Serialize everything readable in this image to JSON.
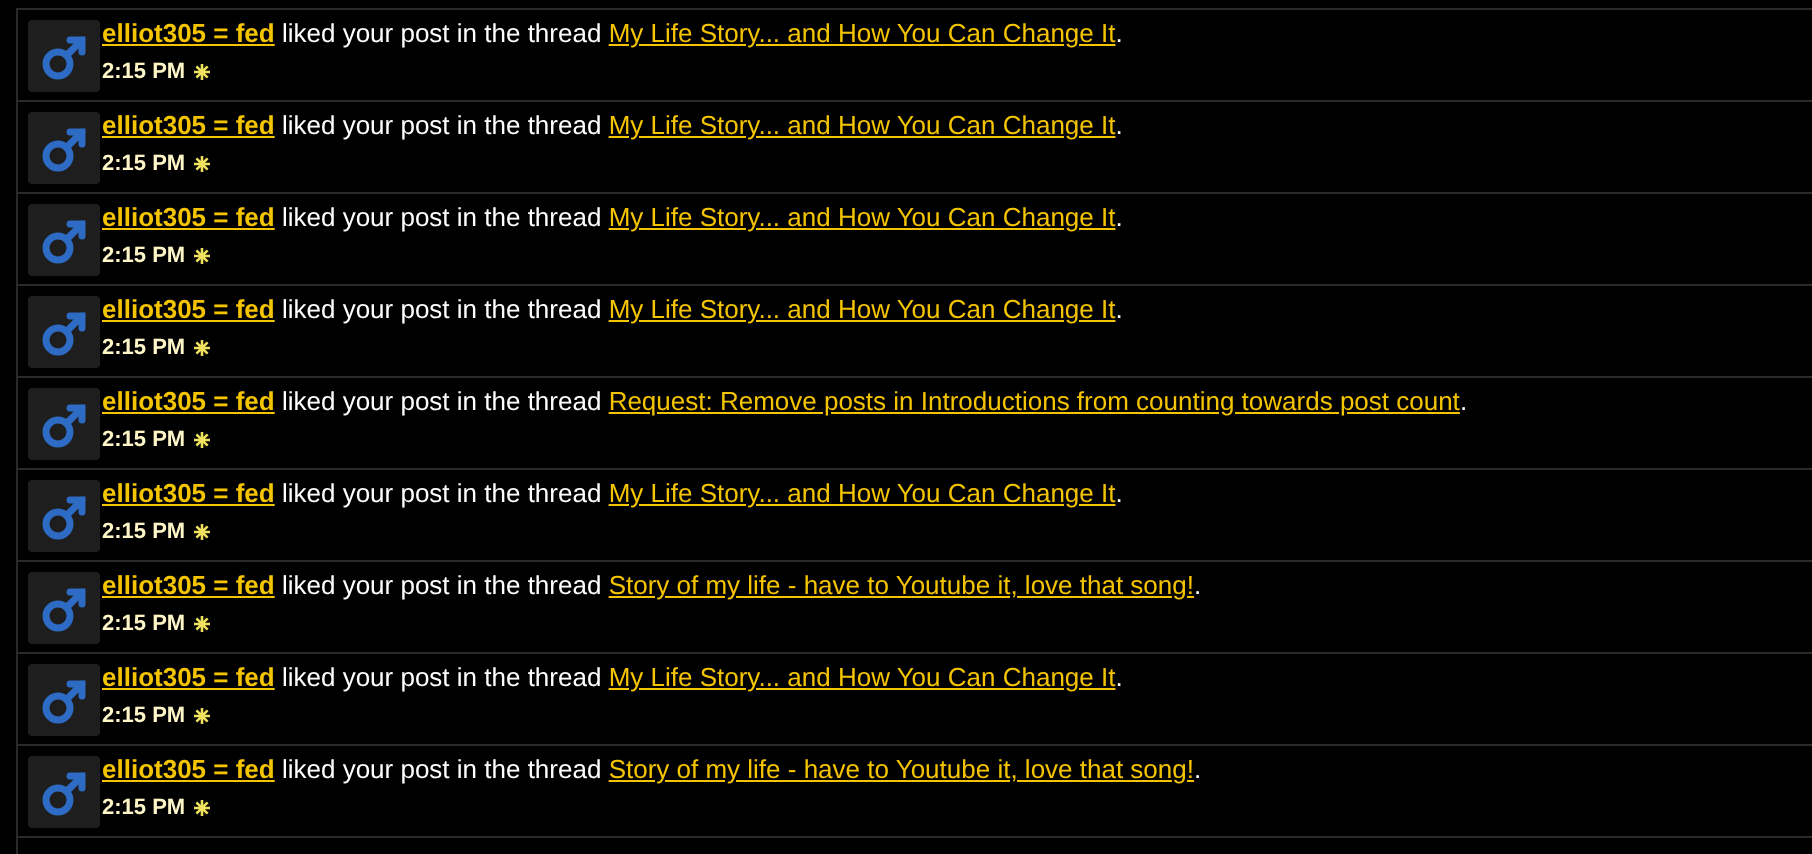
{
  "notifications": [
    {
      "user": "elliot305 = fed",
      "action": "liked your post in the thread",
      "thread": "My Life Story... and How You Can Change It",
      "end": ".",
      "time": "2:15 PM",
      "unread": true
    },
    {
      "user": "elliot305 = fed",
      "action": "liked your post in the thread",
      "thread": "My Life Story... and How You Can Change It",
      "end": ".",
      "time": "2:15 PM",
      "unread": true
    },
    {
      "user": "elliot305 = fed",
      "action": "liked your post in the thread",
      "thread": "My Life Story... and How You Can Change It",
      "end": ".",
      "time": "2:15 PM",
      "unread": true
    },
    {
      "user": "elliot305 = fed",
      "action": "liked your post in the thread",
      "thread": "My Life Story... and How You Can Change It",
      "end": ".",
      "time": "2:15 PM",
      "unread": true
    },
    {
      "user": "elliot305 = fed",
      "action": "liked your post in the thread",
      "thread": "Request: Remove posts in Introductions from counting towards post count",
      "end": ".",
      "time": "2:15 PM",
      "unread": true
    },
    {
      "user": "elliot305 = fed",
      "action": "liked your post in the thread",
      "thread": "My Life Story... and How You Can Change It",
      "end": ".",
      "time": "2:15 PM",
      "unread": true
    },
    {
      "user": "elliot305 = fed",
      "action": "liked your post in the thread",
      "thread": "Story of my life - have to Youtube it, love that song!",
      "end": ".",
      "time": "2:15 PM",
      "unread": true
    },
    {
      "user": "elliot305 = fed",
      "action": "liked your post in the thread",
      "thread": "My Life Story... and How You Can Change It",
      "end": ".",
      "time": "2:15 PM",
      "unread": true
    },
    {
      "user": "elliot305 = fed",
      "action": "liked your post in the thread",
      "thread": "Story of my life - have to Youtube it, love that song!",
      "end": ".",
      "time": "2:15 PM",
      "unread": true
    }
  ]
}
